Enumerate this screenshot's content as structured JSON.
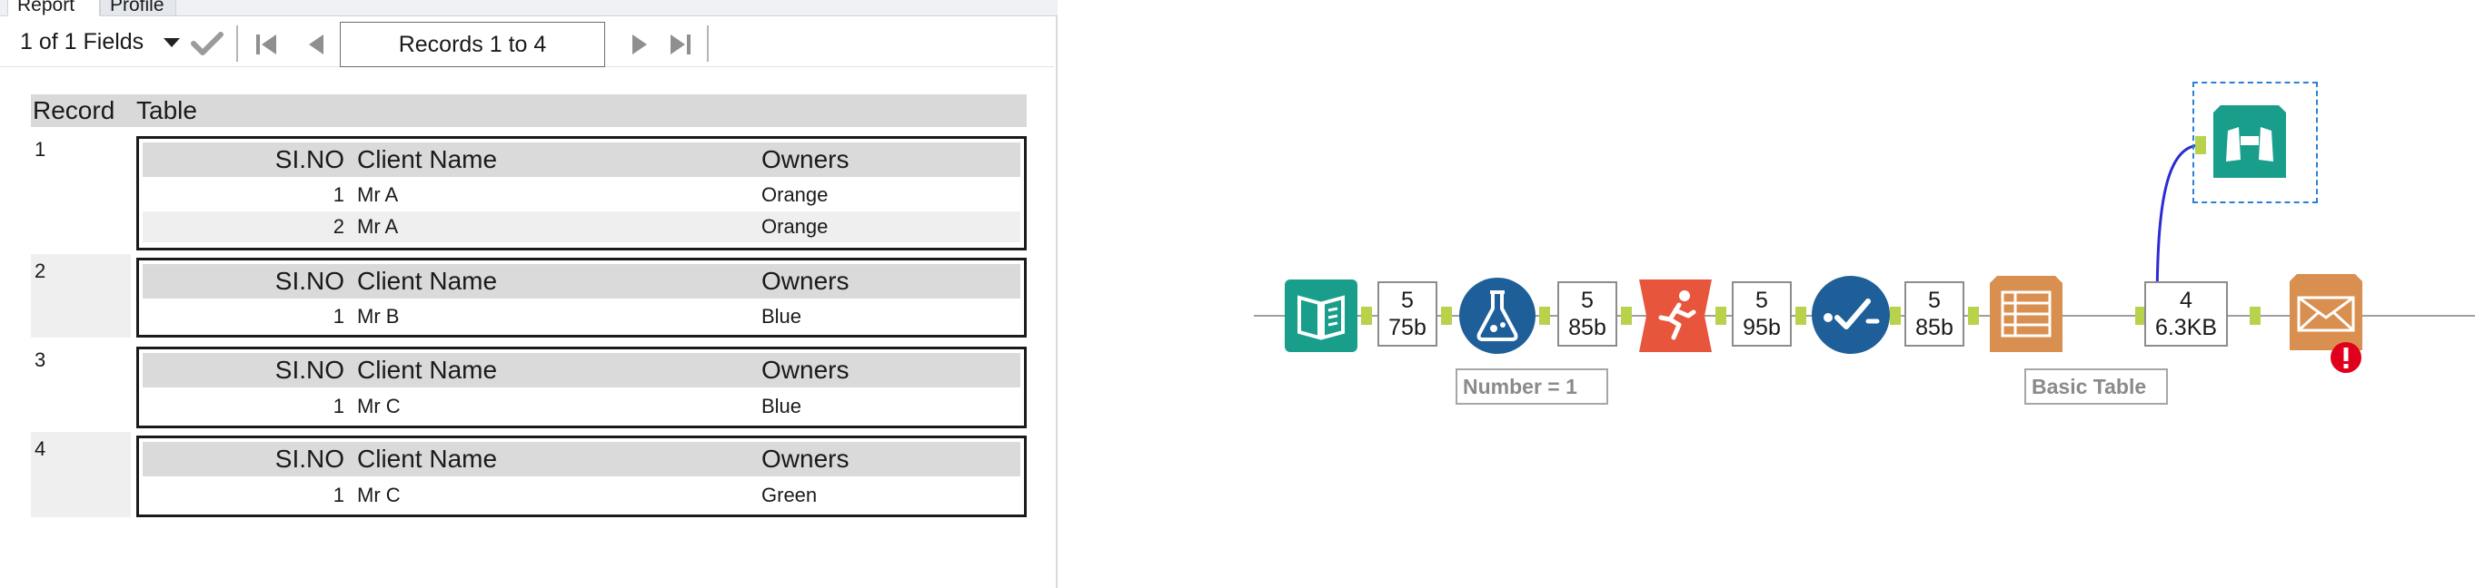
{
  "tabs": {
    "report": "Report",
    "profile": "Profile"
  },
  "toolbar": {
    "fields": "1 of 1 Fields",
    "records": "Records 1 to 4"
  },
  "report": {
    "header_record": "Record",
    "header_table": "Table",
    "columns": [
      "SI.NO",
      "Client Name",
      "Owners"
    ],
    "records": [
      {
        "num": "1",
        "rows": [
          [
            "1",
            "Mr A",
            "Orange"
          ],
          [
            "2",
            "Mr A",
            "Orange"
          ]
        ]
      },
      {
        "num": "2",
        "rows": [
          [
            "1",
            "Mr B",
            "Blue"
          ]
        ]
      },
      {
        "num": "3",
        "rows": [
          [
            "1",
            "Mr C",
            "Blue"
          ]
        ]
      },
      {
        "num": "4",
        "rows": [
          [
            "1",
            "Mr C",
            "Green"
          ]
        ]
      }
    ]
  },
  "workflow": {
    "counts": [
      {
        "records": "5",
        "size": "75b"
      },
      {
        "records": "5",
        "size": "85b"
      },
      {
        "records": "5",
        "size": "95b"
      },
      {
        "records": "5",
        "size": "85b"
      },
      {
        "records": "4",
        "size": "6.3KB"
      }
    ],
    "annotations": {
      "formula": "Number = 1",
      "table": "Basic Table"
    },
    "colors": {
      "input": "#1a9e8c",
      "formula": "#1e5f99",
      "sample": "#e8553d",
      "summarize": "#1e5f99",
      "table": "#d98f4f",
      "browse": "#1a9e8c",
      "email": "#d98f4f",
      "error": "#e0001b",
      "connector_blue": "#2b2bd6"
    },
    "icons": [
      "book-icon",
      "flask-icon",
      "runner-icon",
      "checkmark-flow-icon",
      "table-document-icon",
      "binoculars-icon",
      "envelope-icon",
      "error-icon"
    ]
  }
}
